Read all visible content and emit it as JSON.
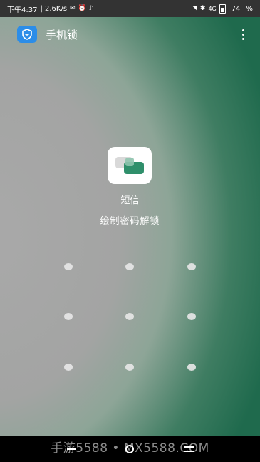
{
  "status_bar": {
    "time": "下午4:37",
    "speed": "| 2.6K/s",
    "network": "4G",
    "battery": "74",
    "battery_unit": "%"
  },
  "app_bar": {
    "title": "手机锁"
  },
  "lock": {
    "app_name": "短信",
    "hint": "绘制密码解锁"
  },
  "pattern": {
    "rows": 3,
    "cols": 3
  },
  "watermark": "手游5588 • MX5588.COM",
  "colors": {
    "accent_green": "#2f8f6b",
    "logo_blue": "#2c8de8"
  }
}
